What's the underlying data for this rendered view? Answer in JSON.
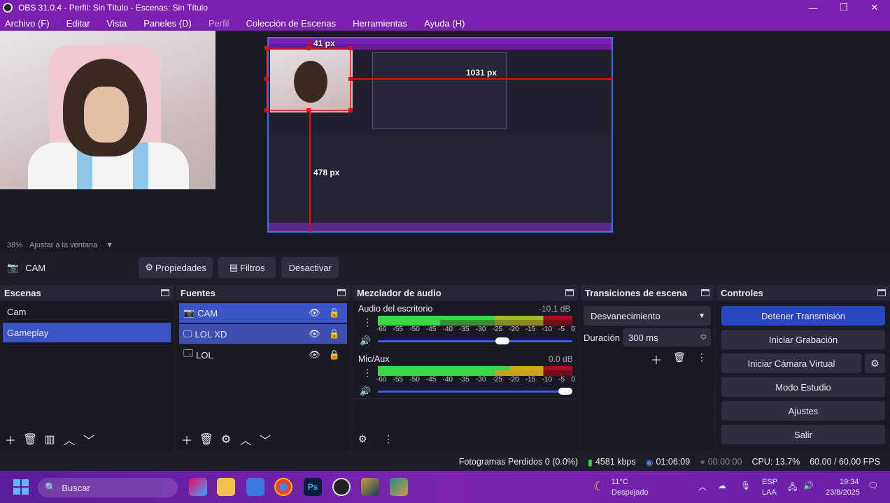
{
  "titlebar": {
    "title": "OBS 31.0.4 - Perfil: Sin Título - Escenas: Sin Título",
    "minimize": "—",
    "maximize": "❐",
    "close": "✕"
  },
  "menu": [
    "Archivo (F)",
    "Editar",
    "Vista",
    "Paneles (D)",
    "Perfil",
    "Colección de Escenas",
    "Herramientas",
    "Ayuda (H)"
  ],
  "preview": {
    "measure_top": "41 px",
    "measure_right": "1031 px",
    "measure_bottom": "478 px"
  },
  "zoom": {
    "level": "38%",
    "fit": "Ajustar a la ventana"
  },
  "source_bar": {
    "source_name": "CAM",
    "properties": "Propiedades",
    "filters": "Filtros",
    "deactivate": "Desactivar"
  },
  "scenes": {
    "title": "Escenas",
    "items": [
      "Cam",
      "Gameplay"
    ],
    "selected": 1
  },
  "sources": {
    "title": "Fuentes",
    "items": [
      {
        "name": "CAM",
        "icon": "camera-icon"
      },
      {
        "name": "LOL XD",
        "icon": "monitor-icon"
      },
      {
        "name": "LOL",
        "icon": "window-icon"
      }
    ]
  },
  "mixer": {
    "title": "Mezclador de audio",
    "channels": [
      {
        "name": "Audio del escritorio",
        "db": "-10.1 dB",
        "level": 0.8
      },
      {
        "name": "Mic/Aux",
        "db": "0.0 dB",
        "level": 1.0
      }
    ],
    "ticks": [
      "-60",
      "-55",
      "-50",
      "-45",
      "-40",
      "-35",
      "-30",
      "-25",
      "-20",
      "-15",
      "-10",
      "-5",
      "0"
    ]
  },
  "transitions": {
    "title": "Transiciones de escena",
    "selected": "Desvanecimiento",
    "duration_label": "Duración",
    "duration_value": "300 ms"
  },
  "controls": {
    "title": "Controles",
    "buttons": [
      "Detener Transmisión",
      "Iniciar Grabación",
      "Iniciar Cámara Virtual",
      "Modo Estudio",
      "Ajustes",
      "Salir"
    ]
  },
  "status": {
    "dropped": "Fotogramas Perdidos 0 (0.0%)",
    "bitrate": "4581 kbps",
    "stream_time": "01:06:09",
    "rec_time": "00:00:00",
    "cpu": "CPU: 13.7%",
    "fps": "60.00 / 60.00 FPS"
  },
  "taskbar": {
    "search": "Buscar",
    "weather_temp": "11°C",
    "weather_desc": "Despejado",
    "lang1": "ESP",
    "lang2": "LAA",
    "time": "19:34",
    "date": "23/8/2025"
  },
  "colors": {
    "accent": "#7a1fb0",
    "selected": "#3b55c6",
    "stream_button": "#2a45c0",
    "measure_line": "#e01010"
  }
}
